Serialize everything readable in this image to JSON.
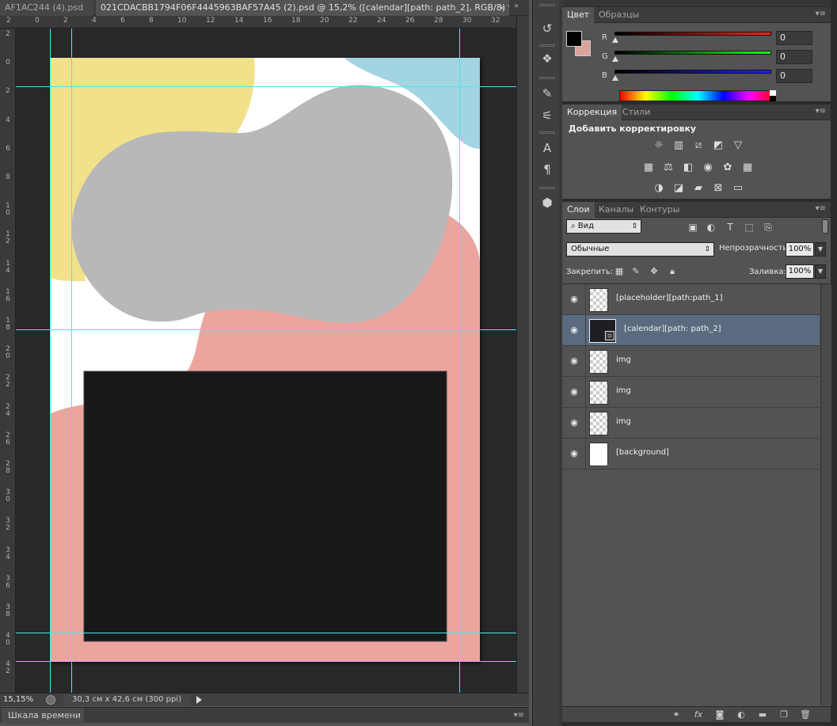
{
  "document_tabs": [
    {
      "label": "AF1AC244 (4).psd",
      "close": "×"
    },
    {
      "label": "021CDACBB1794F06F4445963BAF57A45 (2).psd @ 15,2% ([calendar][path: path_2], RGB/8) *",
      "close": "×"
    }
  ],
  "tabs_menu_icon": "double-chevron-right-icon",
  "ruler": {
    "top_labels": [
      "2",
      "0",
      "2",
      "4",
      "6",
      "8",
      "10",
      "12",
      "14",
      "16",
      "18",
      "20",
      "22",
      "24",
      "26",
      "28",
      "30",
      "32"
    ],
    "left_labels": [
      "2",
      "0",
      "2",
      "4",
      "6",
      "8",
      "10",
      "12",
      "14",
      "16",
      "18",
      "20",
      "22",
      "24",
      "26",
      "28",
      "30",
      "32",
      "34",
      "36",
      "38",
      "40",
      "42"
    ]
  },
  "status": {
    "zoom": "15,15%",
    "doc_size": "30,3 см x 42,6 см (300 ppi)"
  },
  "timeline": {
    "label": "Шкала времени"
  },
  "tools": [
    {
      "icon": "history-brush-icon",
      "glyph": "↺"
    },
    {
      "icon": "3d-object-icon",
      "glyph": "❖"
    },
    {
      "icon": "brush-presets-icon",
      "glyph": "✎"
    },
    {
      "icon": "clone-source-icon",
      "glyph": "⚟"
    },
    {
      "icon": "character-icon",
      "glyph": "A"
    },
    {
      "icon": "paragraph-icon",
      "glyph": "¶"
    },
    {
      "icon": "3d-cube-icon",
      "glyph": "⬢"
    }
  ],
  "color_panel": {
    "tabs": [
      "Цвет",
      "Образцы"
    ],
    "foreground": "#000000",
    "background": "#dca39c",
    "channels": [
      {
        "label": "R",
        "value": "0",
        "color": "#ff2020"
      },
      {
        "label": "G",
        "value": "0",
        "color": "#20ff20"
      },
      {
        "label": "B",
        "value": "0",
        "color": "#2020ff"
      }
    ]
  },
  "adjustments_panel": {
    "tabs": [
      "Коррекция",
      "Стили"
    ],
    "title": "Добавить корректировку",
    "icons": [
      {
        "name": "brightness-contrast-icon",
        "glyph": "☼"
      },
      {
        "name": "levels-icon",
        "glyph": "▥"
      },
      {
        "name": "curves-icon",
        "glyph": "⧄"
      },
      {
        "name": "exposure-icon",
        "glyph": "◩"
      },
      {
        "name": "vibrance-icon",
        "glyph": "▽"
      },
      {
        "name": "hue-saturation-icon",
        "glyph": "▦"
      },
      {
        "name": "color-balance-icon",
        "glyph": "⚖"
      },
      {
        "name": "black-white-icon",
        "glyph": "◧"
      },
      {
        "name": "photo-filter-icon",
        "glyph": "◉"
      },
      {
        "name": "channel-mixer-icon",
        "glyph": "✿"
      },
      {
        "name": "color-lookup-icon",
        "glyph": "▦"
      },
      {
        "name": "invert-icon",
        "glyph": "◑"
      },
      {
        "name": "posterize-icon",
        "glyph": "◪"
      },
      {
        "name": "threshold-icon",
        "glyph": "▰"
      },
      {
        "name": "selective-color-icon",
        "glyph": "⊠"
      },
      {
        "name": "gradient-map-icon",
        "glyph": "▭"
      }
    ]
  },
  "layers_panel": {
    "tabs": [
      "Слои",
      "Каналы",
      "Контуры"
    ],
    "kind_filter": "Вид",
    "blend_mode": "Обычные",
    "opacity_label": "Непрозрачность:",
    "opacity": "100%",
    "lock_label": "Закрепить:",
    "fill_label": "Заливка:",
    "fill": "100%",
    "layers": [
      {
        "name": "[placeholder][path:path_1]",
        "thumb": "grey-blob",
        "selected": false
      },
      {
        "name": "[calendar][path: path_2]",
        "thumb": "dark",
        "selected": true
      },
      {
        "name": "img",
        "thumb": "transparent",
        "selected": false
      },
      {
        "name": "img",
        "thumb": "pink",
        "selected": false
      },
      {
        "name": "img",
        "thumb": "yellow",
        "selected": false
      },
      {
        "name": "[background]",
        "thumb": "white",
        "selected": false
      }
    ],
    "bottom_icons": [
      "link-layers-icon",
      "fx-icon",
      "add-mask-icon",
      "new-adjustment-icon",
      "new-group-icon",
      "new-layer-icon",
      "delete-icon"
    ]
  },
  "canvas_colors": {
    "yellow": "#f1e189",
    "blue": "#a2d4e2",
    "grey": "#b8b8b8",
    "pink": "#eba59e",
    "calendar": "#181818"
  }
}
